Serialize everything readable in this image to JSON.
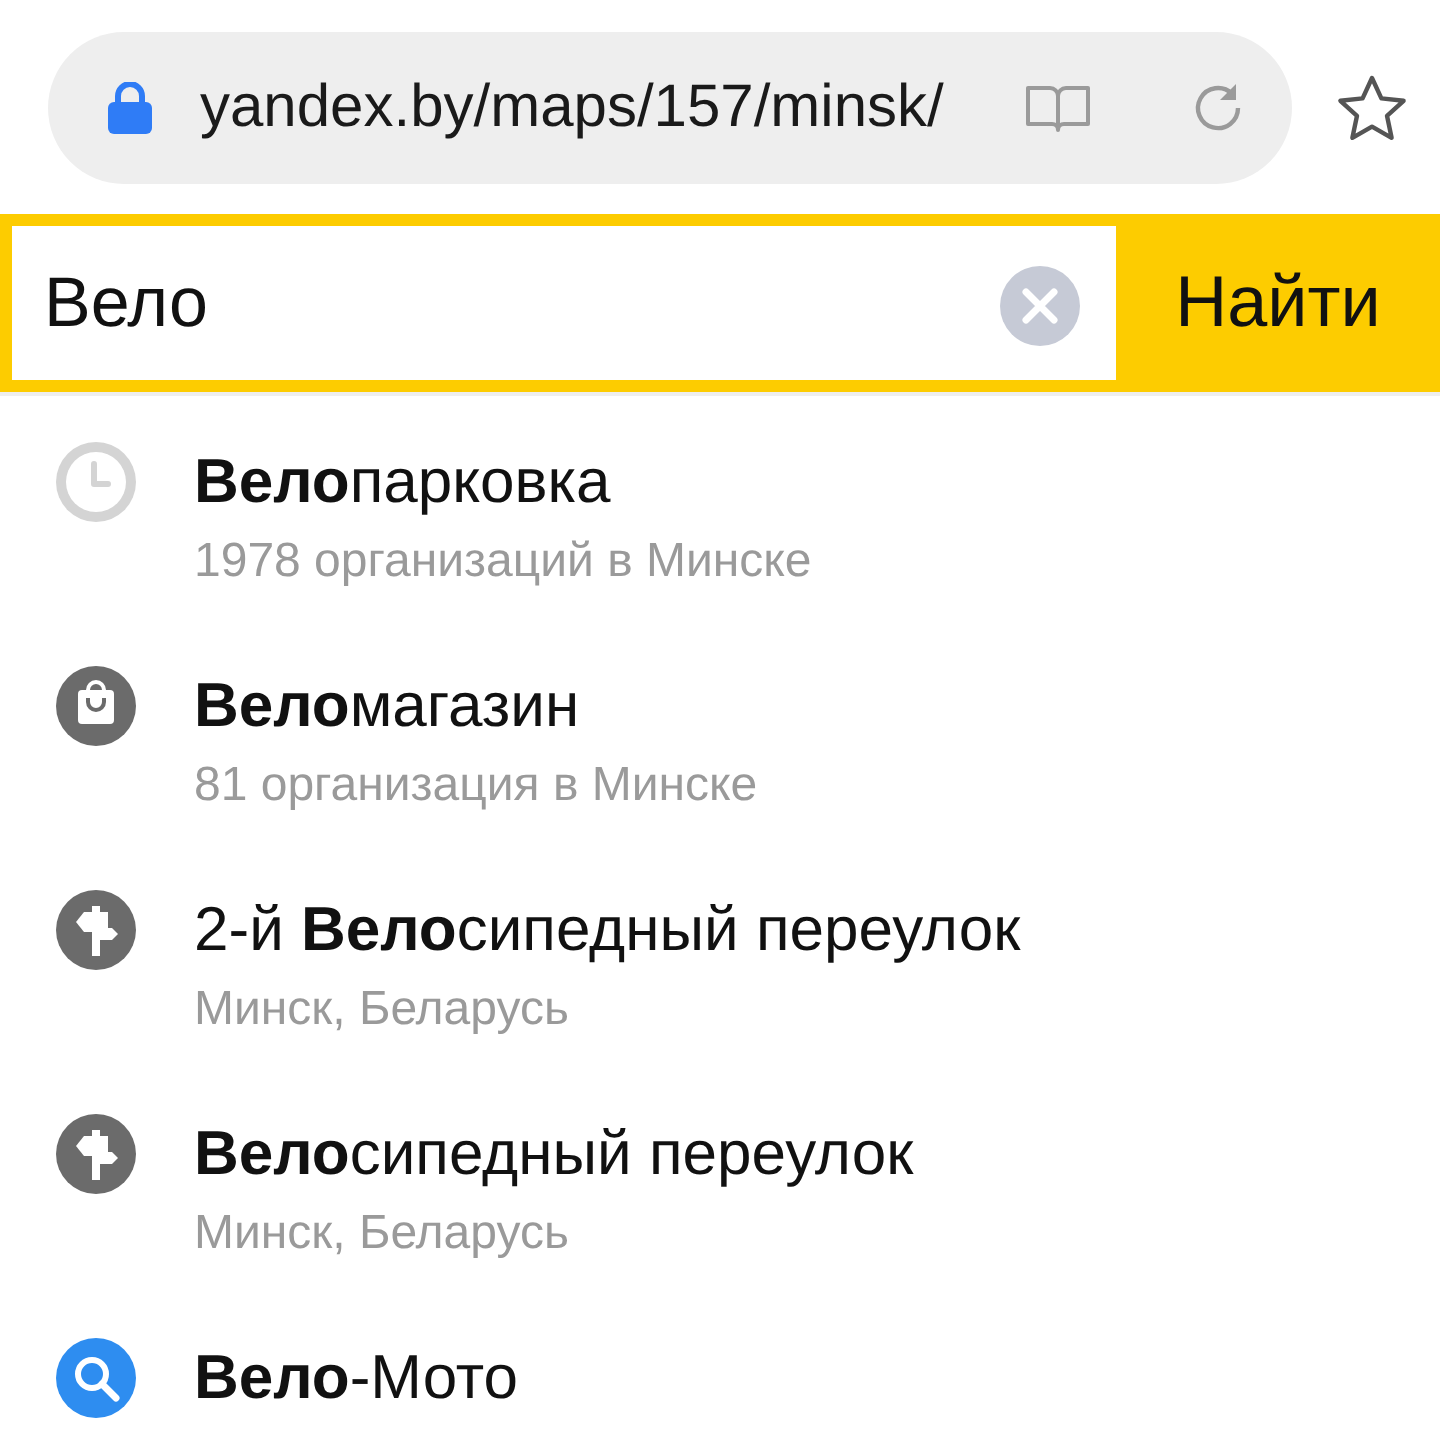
{
  "browser": {
    "url": "yandex.by/maps/157/minsk/"
  },
  "search": {
    "value": "Вело",
    "button": "Найти"
  },
  "suggestions": [
    {
      "kind": "history",
      "title": "**Вело**парковка",
      "subtitle": "1978 организаций в Минске"
    },
    {
      "kind": "category",
      "title": "**Вело**магазин",
      "subtitle": "81 организация в Минске"
    },
    {
      "kind": "street",
      "title": "2-й **Вело**сипедный переулок",
      "subtitle": "Минск, Беларусь"
    },
    {
      "kind": "street",
      "title": "**Вело**сипедный переулок",
      "subtitle": "Минск, Беларусь"
    },
    {
      "kind": "search",
      "title": "**Вело**-Мото"
    }
  ]
}
